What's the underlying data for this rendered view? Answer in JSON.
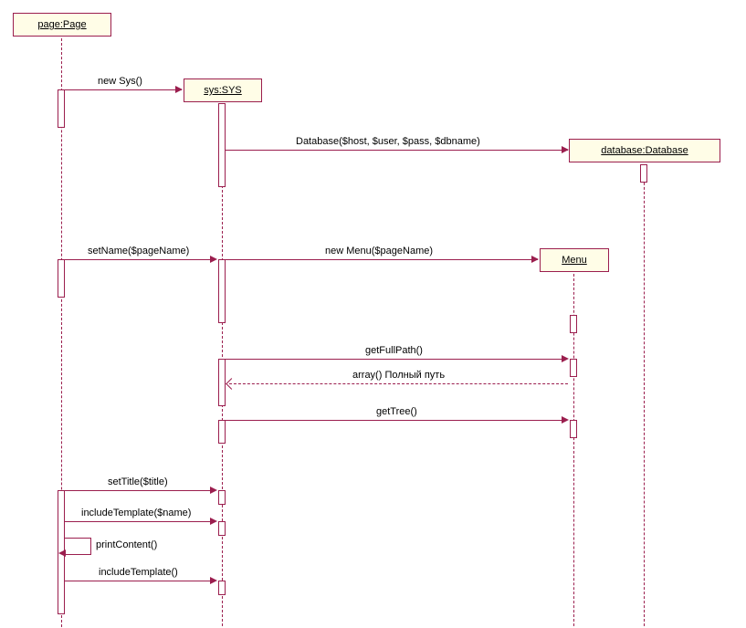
{
  "lifelines": {
    "page": "page:Page",
    "sys": "sys:SYS",
    "database": "database:Database",
    "menu": "Menu"
  },
  "messages": {
    "new_sys": "new Sys()",
    "database_call": "Database($host, $user, $pass, $dbname)",
    "set_name": "setName($pageName)",
    "new_menu": "new Menu($pageName)",
    "get_full_path": "getFullPath()",
    "full_path_return": "array() Полный путь",
    "get_tree": "getTree()",
    "set_title": "setTitle($title)",
    "include_template1": "includeTemplate($name)",
    "print_content": "printContent()",
    "include_template2": "includeTemplate()"
  }
}
